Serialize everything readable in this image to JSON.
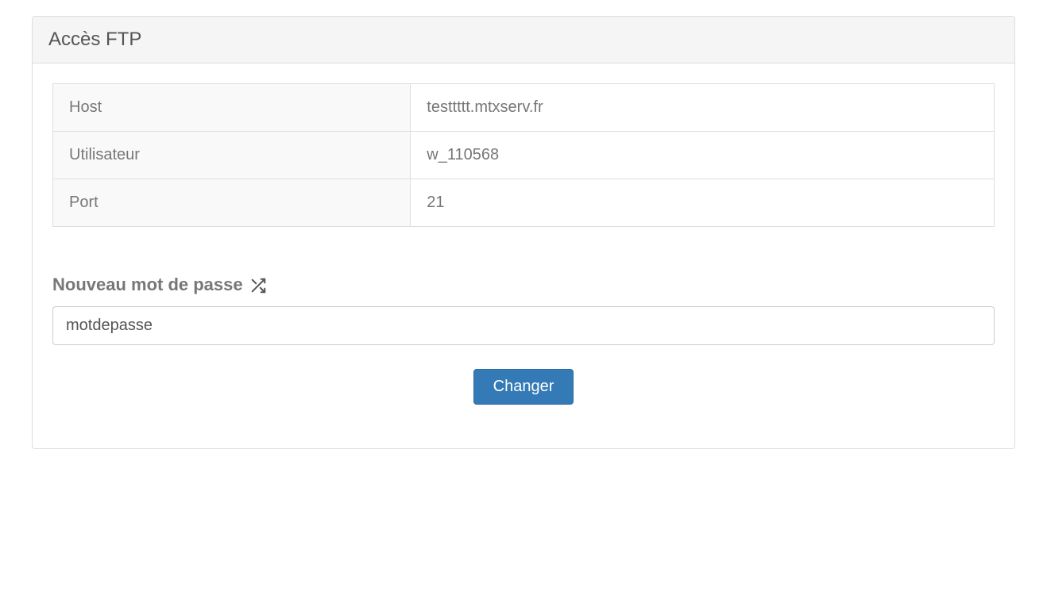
{
  "panel": {
    "title": "Accès FTP"
  },
  "table": {
    "rows": [
      {
        "label": "Host",
        "value": "testtttt.mtxserv.fr"
      },
      {
        "label": "Utilisateur",
        "value": "w_110568"
      },
      {
        "label": "Port",
        "value": "21"
      }
    ]
  },
  "form": {
    "password_label": "Nouveau mot de passe",
    "password_value": "motdepasse",
    "submit_label": "Changer"
  }
}
